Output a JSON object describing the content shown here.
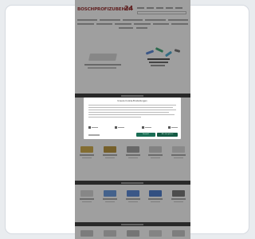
{
  "page": {
    "logo_text": "BOSCHPROFIZUBEHÖR",
    "logo_suffix": "24"
  },
  "cookie_dialog": {
    "title": "Unsere Cookie-Einstellungen",
    "options": [
      "Notwendig",
      "Statistik",
      "Marketing",
      "Funktional"
    ],
    "accept_selected_label": "Auswahl",
    "accept_all_label": "Alle akzeptieren"
  },
  "colors": {
    "logo": "#8b1a1a",
    "accept": "#1a6e55",
    "accept_all": "#155b45",
    "section_strip": "#2b2b2b"
  }
}
